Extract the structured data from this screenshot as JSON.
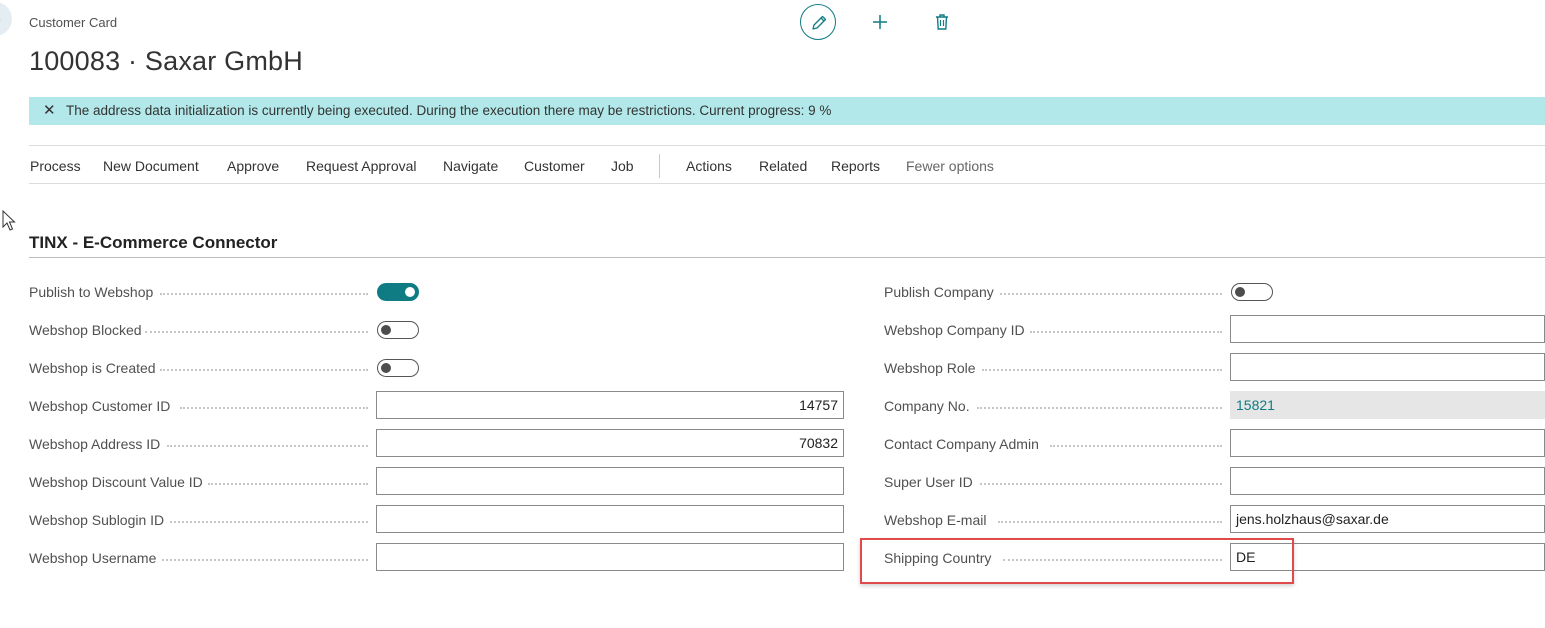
{
  "page": {
    "caption": "Customer Card",
    "title": "100083 · Saxar GmbH"
  },
  "toolbar": {
    "edit_icon": "pencil-icon",
    "new_icon": "plus-icon",
    "delete_icon": "trash-icon"
  },
  "banner": {
    "message": "The address data initialization is currently being executed. During the execution there may be restrictions. Current progress: 9 %",
    "close_icon": "close-icon",
    "color": "#b2e8e9"
  },
  "actions": {
    "items": [
      "Process",
      "New Document",
      "Approve",
      "Request Approval",
      "Navigate",
      "Customer",
      "Job"
    ],
    "secondary": [
      "Actions",
      "Related",
      "Reports",
      "Fewer options"
    ]
  },
  "section": {
    "title": "TINX - E-Commerce Connector"
  },
  "left_fields": [
    {
      "label": "Publish to Webshop",
      "type": "toggle",
      "on": true
    },
    {
      "label": "Webshop Blocked",
      "type": "toggle",
      "on": false
    },
    {
      "label": "Webshop is Created",
      "type": "toggle",
      "on": false
    },
    {
      "label": "Webshop Customer ID",
      "type": "input",
      "value": "14757"
    },
    {
      "label": "Webshop Address ID",
      "type": "input",
      "value": "70832"
    },
    {
      "label": "Webshop Discount Value ID",
      "type": "input",
      "value": ""
    },
    {
      "label": "Webshop Sublogin ID",
      "type": "input",
      "value": ""
    },
    {
      "label": "Webshop Username",
      "type": "input",
      "value": ""
    }
  ],
  "right_fields": [
    {
      "label": "Publish Company",
      "type": "toggle",
      "on": false
    },
    {
      "label": "Webshop Company ID",
      "type": "input",
      "value": ""
    },
    {
      "label": "Webshop Role",
      "type": "input",
      "value": ""
    },
    {
      "label": "Company No.",
      "type": "readonly",
      "value": "15821"
    },
    {
      "label": "Contact Company Admin",
      "type": "input",
      "value": ""
    },
    {
      "label": "Super User ID",
      "type": "input",
      "value": ""
    },
    {
      "label": "Webshop E-mail",
      "type": "input",
      "value": "jens.holzhaus@saxar.de"
    },
    {
      "label": "Shipping Country",
      "type": "input",
      "value": "DE"
    }
  ],
  "colors": {
    "accent": "#0f7b83",
    "highlight": "#e04a4a"
  }
}
